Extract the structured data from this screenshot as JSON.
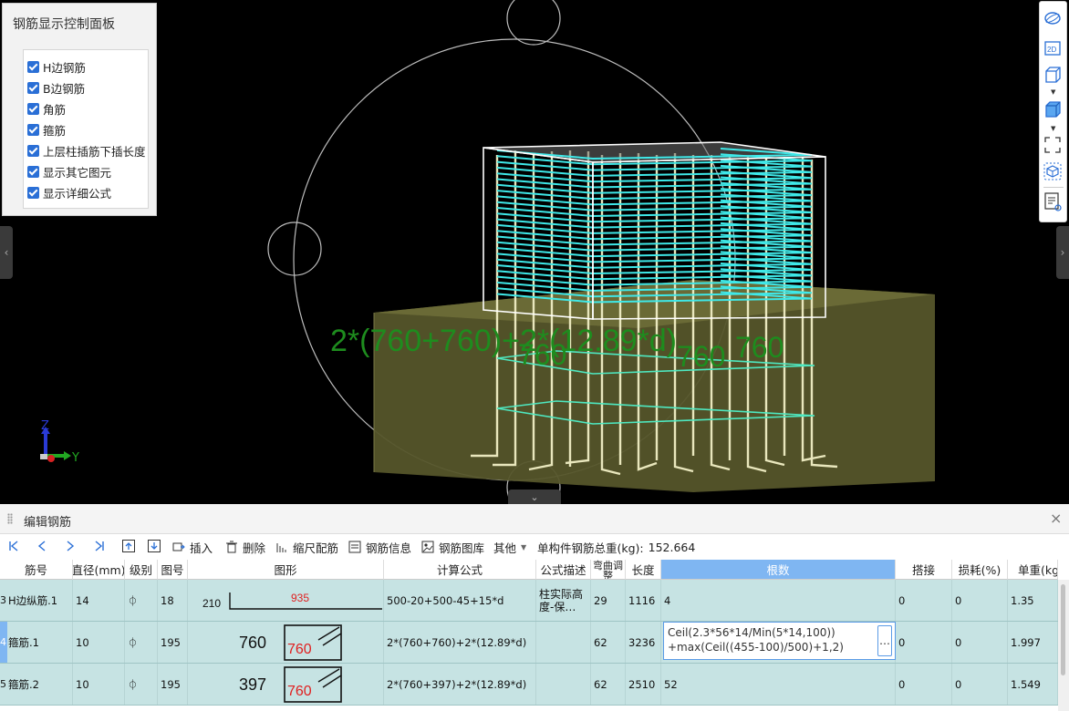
{
  "viewport": {
    "control_panel": {
      "title": "钢筋显示控制面板",
      "options": [
        {
          "label": "H边钢筋",
          "checked": true
        },
        {
          "label": "B边钢筋",
          "checked": true
        },
        {
          "label": "角筋",
          "checked": true
        },
        {
          "label": "箍筋",
          "checked": true
        },
        {
          "label": "上层柱插筋下插长度",
          "checked": true
        },
        {
          "label": "显示其它图元",
          "checked": true
        },
        {
          "label": "显示详细公式",
          "checked": true
        }
      ]
    },
    "overlay_texts": {
      "formula": "2*(760+760)+2*(12.89*d)",
      "dim_760_a": "760",
      "dim_760_b": "760",
      "dim_760_c": "760"
    },
    "axis": {
      "z": "Z",
      "y": "Y"
    },
    "right_toolbar": {
      "icons": [
        "ellipse-icon",
        "view-2d-icon",
        "cube-outline-icon",
        "cube-solid-icon",
        "fullscreen-icon",
        "cube-settings-icon",
        "properties-icon"
      ],
      "label_2d": "2D"
    },
    "colors": {
      "stirrup": "#3fe8e8",
      "rebar": "#e9e7bd",
      "concrete": "#55552a",
      "dim_text": "#1e8c1e"
    }
  },
  "panel": {
    "title": "编辑钢筋",
    "toolbar": {
      "insert": "插入",
      "delete": "删除",
      "scale": "缩尺配筋",
      "info": "钢筋信息",
      "library": "钢筋图库",
      "other": "其他",
      "total_label": "单构件钢筋总重(kg):",
      "total_value": "152.664"
    },
    "columns": [
      "筋号",
      "直径(mm)",
      "级别",
      "图号",
      "图形",
      "计算公式",
      "公式描述",
      "弯曲调整",
      "长度",
      "根数",
      "搭接",
      "损耗(%)",
      "单重(kg"
    ],
    "rows": [
      {
        "num": "3",
        "name": "H边纵筋.1",
        "diameter": "14",
        "grade": "⏀",
        "figure": "18",
        "shape": {
          "left": "210",
          "right": "935"
        },
        "formula": "500-20+500-45+15*d",
        "desc": "柱实际高度-保…",
        "bend": "29",
        "length": "1116",
        "count": "4",
        "lap": "0",
        "loss": "0",
        "unit_weight": "1.35"
      },
      {
        "num": "4",
        "name": "箍筋.1",
        "diameter": "10",
        "grade": "⏀",
        "figure": "195",
        "shape": {
          "outer": "760",
          "inner": "760"
        },
        "formula": "2*(760+760)+2*(12.89*d)",
        "desc": "",
        "bend": "62",
        "length": "3236",
        "count": "Ceil(2.3*56*14/Min(5*14,100))\n+max(Ceil((455-100)/500)+1,2)",
        "lap": "0",
        "loss": "0",
        "unit_weight": "1.997"
      },
      {
        "num": "5",
        "name": "箍筋.2",
        "diameter": "10",
        "grade": "⏀",
        "figure": "195",
        "shape": {
          "outer": "397",
          "inner": "760"
        },
        "formula": "2*(760+397)+2*(12.89*d)",
        "desc": "",
        "bend": "62",
        "length": "2510",
        "count": "52",
        "lap": "0",
        "loss": "0",
        "unit_weight": "1.549"
      }
    ],
    "editor_button": "…",
    "close": "×"
  }
}
